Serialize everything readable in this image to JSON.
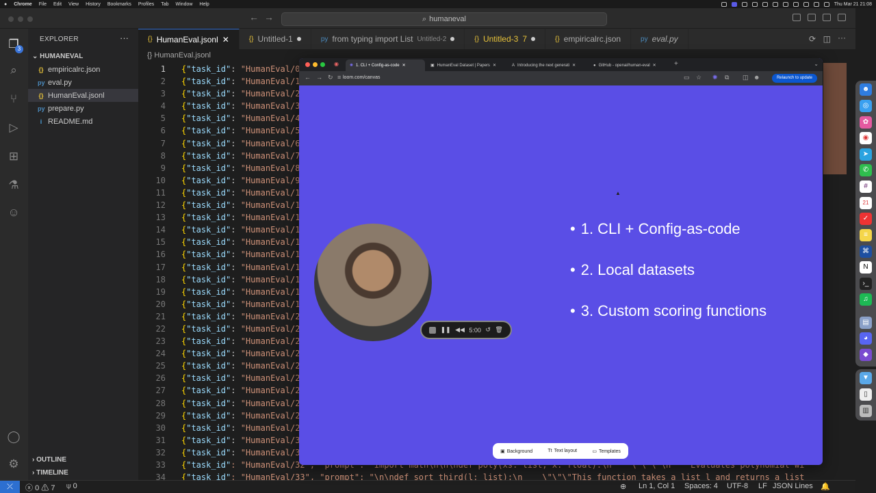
{
  "menubar": {
    "app": "Chrome",
    "items": [
      "File",
      "Edit",
      "View",
      "History",
      "Bookmarks",
      "Profiles",
      "Tab",
      "Window",
      "Help"
    ],
    "clock": "Thu Mar 21  21:08"
  },
  "window": {
    "command_center": "humaneval"
  },
  "activity": {
    "badge": "3"
  },
  "explorer": {
    "title": "EXPLORER",
    "folder": "HUMANEVAL",
    "files": [
      {
        "name": "empiricalrc.json",
        "icon": "{}"
      },
      {
        "name": "eval.py",
        "icon": "py"
      },
      {
        "name": "HumanEval.jsonl",
        "icon": "{}"
      },
      {
        "name": "prepare.py",
        "icon": "py"
      },
      {
        "name": "README.md",
        "icon": "i"
      }
    ],
    "outline": "OUTLINE",
    "timeline": "TIMELINE"
  },
  "tabs": [
    {
      "label": "HumanEval.jsonl",
      "icon": "{}",
      "sub": ""
    },
    {
      "label": "Untitled-1",
      "icon": "{}",
      "sub": ""
    },
    {
      "label": "from typing import List",
      "icon": "py",
      "sub": "Untitled-2"
    },
    {
      "label": "Untitled-3",
      "icon": "{}",
      "sub": "7"
    },
    {
      "label": "empiricalrc.json",
      "icon": "{}",
      "sub": ""
    },
    {
      "label": "eval.py",
      "icon": "py",
      "sub": ""
    }
  ],
  "breadcrumb": "{} HumanEval.jsonl",
  "code": {
    "key": "\"task_id\"",
    "value_prefix": "\"HumanEval/",
    "lines": [
      "1",
      "2",
      "3",
      "4",
      "5",
      "6",
      "7",
      "8",
      "9",
      "10",
      "11",
      "12",
      "13",
      "14",
      "15",
      "16",
      "17",
      "18",
      "19",
      "20",
      "21",
      "22",
      "23",
      "24",
      "25",
      "26",
      "27",
      "28",
      "29",
      "30",
      "31",
      "32",
      "33",
      "34"
    ],
    "tail_values": [
      "0",
      "1",
      "2",
      "3",
      "4",
      "5",
      "6",
      "7",
      "8",
      "9",
      "1",
      "1",
      "1",
      "1",
      "1",
      "1",
      "1",
      "1",
      "1",
      "1",
      "2",
      "2",
      "2",
      "2",
      "2",
      "2",
      "2",
      "2",
      "2",
      "2",
      "3",
      "3"
    ],
    "line33": ": \"HumanEval/32\", \"prompt\": \"import math\\n\\n\\ndef poly(xs: list, x: float):\\n    \\\"\\\"\\\"\\n    Evaluates polynomial wi",
    "line34": ": \"HumanEval/33\", \"prompt\": \"\\n\\ndef sort_third(l: list):\\n    \\\"\\\"\\\"This function takes a list l and returns a list"
  },
  "statusbar": {
    "errors": "0",
    "warnings": "7",
    "ports": "0",
    "position": "Ln 1, Col 1",
    "spaces": "Spaces: 4",
    "encoding": "UTF-8",
    "eol": "LF",
    "language": "JSON Lines"
  },
  "browser": {
    "tabs": [
      "1. CLI + Config-as-code",
      "HumanEval Dataset | Papers",
      "Introducing the next generati",
      "GitHub - openai/human-eval"
    ],
    "url": "loom.com/canvas",
    "relaunch": "Relaunch to update",
    "recorder_time": "5:00",
    "bullets": [
      "1. CLI + Config-as-code",
      "2. Local datasets",
      "3. Custom scoring functions"
    ],
    "toolbar": [
      "Background",
      "Text layout",
      "Templates"
    ]
  }
}
